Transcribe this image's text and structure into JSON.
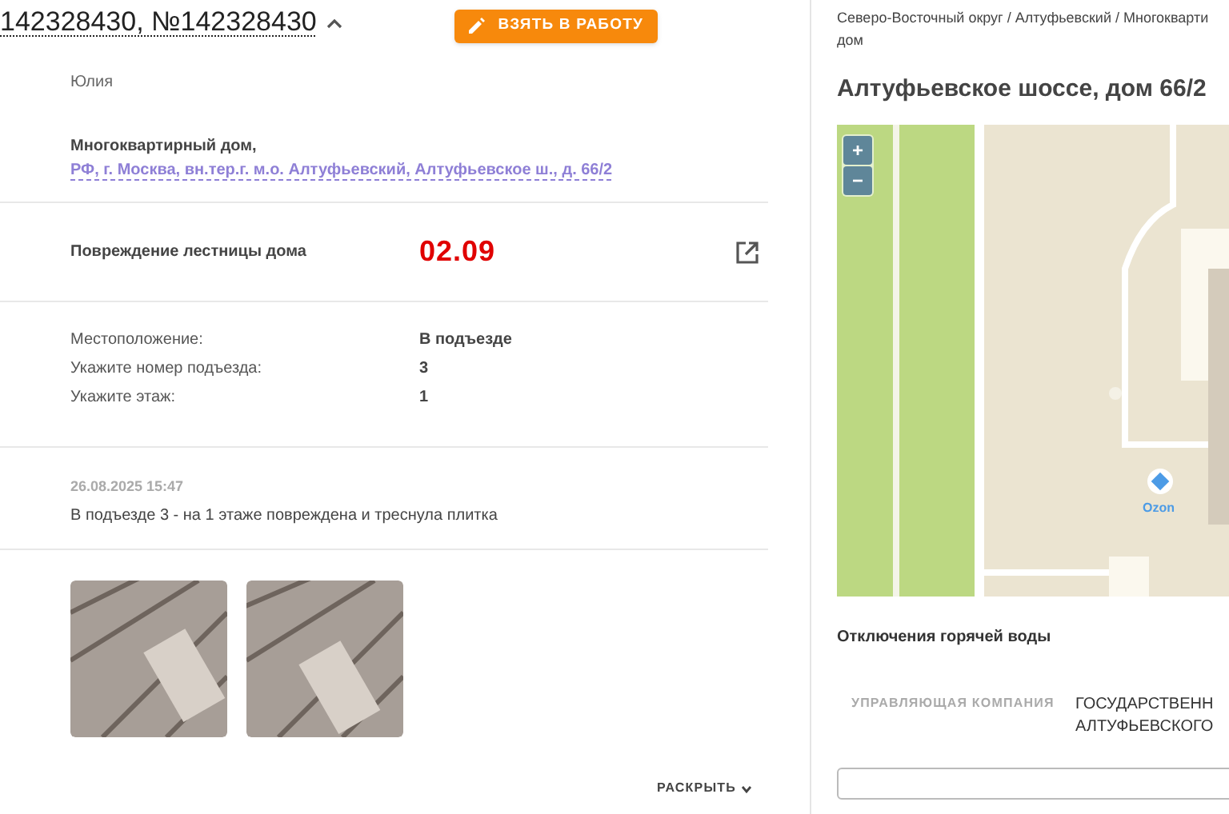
{
  "ticket": {
    "title": "142328430, №142328430",
    "expanded": true,
    "action_button": "ВЗЯТЬ В РАБОТУ"
  },
  "author": "Юлия",
  "address": {
    "type_label": "Многоквартирный дом,",
    "link": "РФ, г. Москва, вн.тер.г. м.о. Алтуфьевский, Алтуфьевское ш., д. 66/2"
  },
  "category": {
    "name": "Повреждение лестницы дома",
    "code": "02.09"
  },
  "details": [
    {
      "label": "Местоположение:",
      "value": "В подъезде"
    },
    {
      "label": "Укажите номер подъезда:",
      "value": "3"
    },
    {
      "label": "Укажите этаж:",
      "value": "1"
    }
  ],
  "comment": {
    "date": "26.08.2025 15:47",
    "text": "В подъезде 3 - на 1 этаже повреждена и треснула плитка"
  },
  "photos": [
    {
      "kind": "photo"
    },
    {
      "kind": "photo"
    }
  ],
  "expand_link": "РАСКРЫТЬ",
  "right_panel": {
    "breadcrumb": [
      "Северо-Восточный округ / Алтуфьевский / Многокварти",
      "дом"
    ],
    "heading": "Алтуфьевское шоссе, дом 66/2",
    "map": {
      "zoom_in": "+",
      "zoom_out": "−",
      "poi_label": "Ozon"
    },
    "section_title": "Отключения горячей воды",
    "company_label": "УПРАВЛЯЮЩАЯ КОМПАНИЯ",
    "company_value": [
      "ГОСУДАРСТВЕНН",
      "АЛТУФЬЕВСКОГО"
    ]
  }
}
